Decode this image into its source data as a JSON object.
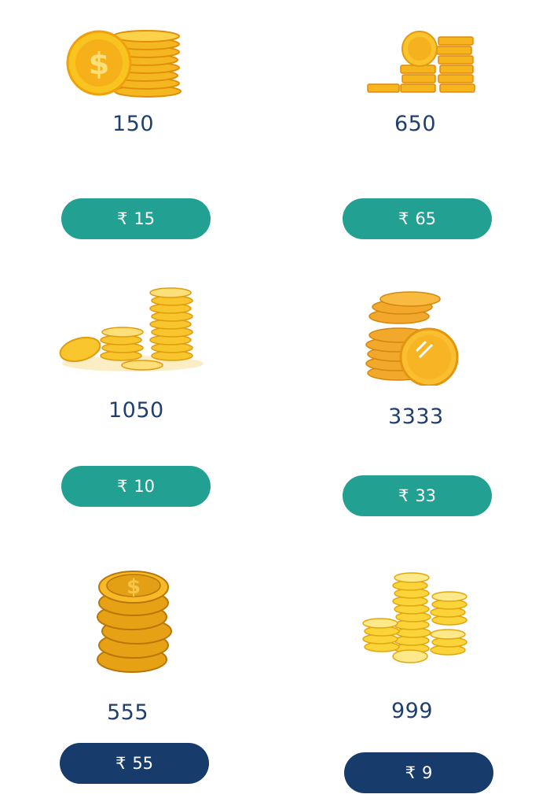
{
  "colors": {
    "amount_text": "#1f3f6e",
    "teal_button": "#22a192",
    "navy_button": "#173b6b",
    "gold": "#f5b71f"
  },
  "packs": [
    {
      "amount": "150",
      "currency": "₹",
      "price": "15",
      "button_style": "teal",
      "icon": "coin-stack-icon"
    },
    {
      "amount": "650",
      "currency": "₹",
      "price": "65",
      "button_style": "teal",
      "icon": "coin-stack-icon"
    },
    {
      "amount": "1050",
      "currency": "₹",
      "price": "10",
      "button_style": "teal",
      "icon": "coin-stack-icon"
    },
    {
      "amount": "3333",
      "currency": "₹",
      "price": "33",
      "button_style": "teal",
      "icon": "coin-stack-icon"
    },
    {
      "amount": "555",
      "currency": "₹",
      "price": "55",
      "button_style": "navy",
      "icon": "coin-stack-icon"
    },
    {
      "amount": "999",
      "currency": "₹",
      "price": "9",
      "button_style": "navy",
      "icon": "coin-stack-icon"
    }
  ]
}
